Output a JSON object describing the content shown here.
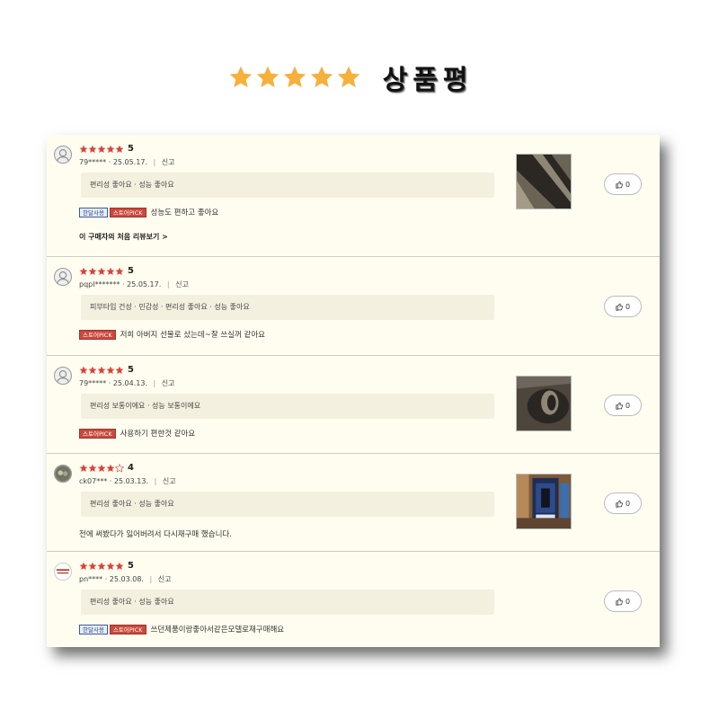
{
  "header": {
    "title": "상품평",
    "star_color": "#f7b03b"
  },
  "reviews": [
    {
      "rating": "5",
      "user": "79*****",
      "date": "· 25.05.17.",
      "separator": "|",
      "report": "신고",
      "attributes": "편리성 좋아요 · 성능 좋아요",
      "badges": [
        "한달사용",
        "스토어PICK"
      ],
      "comment": "성능도 편하고 좋아요",
      "more_link": "이 구매자의 처음 리뷰보기 >",
      "has_photo": true,
      "like_count": "0"
    },
    {
      "rating": "5",
      "user": "pqpl*******",
      "date": "· 25.05.17.",
      "separator": "|",
      "report": "신고",
      "attributes": "피부타입 건성 · 민감성 · 편리성 좋아요 · 성능 좋아요",
      "badges": [
        "스토어PICK"
      ],
      "comment": "저희 아버지 선물로 샀는데~잘 쓰실꺼 같아요",
      "has_photo": false,
      "like_count": "0"
    },
    {
      "rating": "5",
      "user": "79*****",
      "date": "· 25.04.13.",
      "separator": "|",
      "report": "신고",
      "attributes": "편리성 보통이에요 · 성능 보통이에요",
      "badges": [
        "스토어PICK"
      ],
      "comment": "사용하기 편한것 같아요",
      "has_photo": true,
      "like_count": "0"
    },
    {
      "rating": "4",
      "user": "ck07***",
      "date": "· 25.03.13.",
      "separator": "|",
      "report": "신고",
      "attributes": "편리성 좋아요 · 성능 좋아요",
      "badges": [],
      "comment": "전에 써봤다가 잃어버려서 다시재구매 했습니다.",
      "has_photo": true,
      "like_count": "0"
    },
    {
      "rating": "5",
      "user": "pn****",
      "date": "· 25.03.08.",
      "separator": "|",
      "report": "신고",
      "attributes": "편리성 좋아요 · 성능 좋아요",
      "badges": [
        "한달사용",
        "스토어PICK"
      ],
      "comment": "쓰던제품이랑좋아서같은모델로재구매해요",
      "has_photo": false,
      "like_count": "0"
    }
  ]
}
